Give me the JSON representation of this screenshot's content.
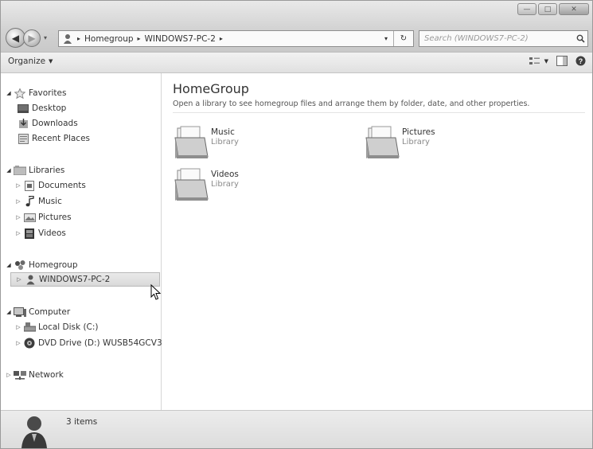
{
  "window": {
    "controls": {
      "minimize": "—",
      "maximize": "□",
      "close": "✕"
    }
  },
  "nav": {
    "back_glyph": "◀",
    "forward_glyph": "▶",
    "dropdown_glyph": "▾"
  },
  "address": {
    "crumbs": [
      "Homegroup",
      "WINDOWS7-PC-2"
    ],
    "separator": "▸",
    "dropdown_glyph": "▾",
    "refresh_glyph": "↻"
  },
  "search": {
    "placeholder": "Search (WINDOWS7-PC-2)"
  },
  "toolbar": {
    "organize": "Organize",
    "organize_arrow": "▼",
    "views_arrow": "▼"
  },
  "sidebar": {
    "favorites": {
      "label": "Favorites",
      "items": [
        "Desktop",
        "Downloads",
        "Recent Places"
      ]
    },
    "libraries": {
      "label": "Libraries",
      "items": [
        "Documents",
        "Music",
        "Pictures",
        "Videos"
      ]
    },
    "homegroup": {
      "label": "Homegroup",
      "items": [
        "WINDOWS7-PC-2"
      ]
    },
    "computer": {
      "label": "Computer",
      "items": [
        "Local Disk (C:)",
        "DVD Drive (D:) WUSB54GCV3"
      ]
    },
    "network": {
      "label": "Network"
    }
  },
  "content": {
    "title": "HomeGroup",
    "description": "Open a library to see homegroup files and arrange them by folder, date, and other properties.",
    "libraries": [
      {
        "name": "Music",
        "kind": "Library"
      },
      {
        "name": "Pictures",
        "kind": "Library"
      },
      {
        "name": "Videos",
        "kind": "Library"
      }
    ]
  },
  "details": {
    "count": "3 items"
  }
}
